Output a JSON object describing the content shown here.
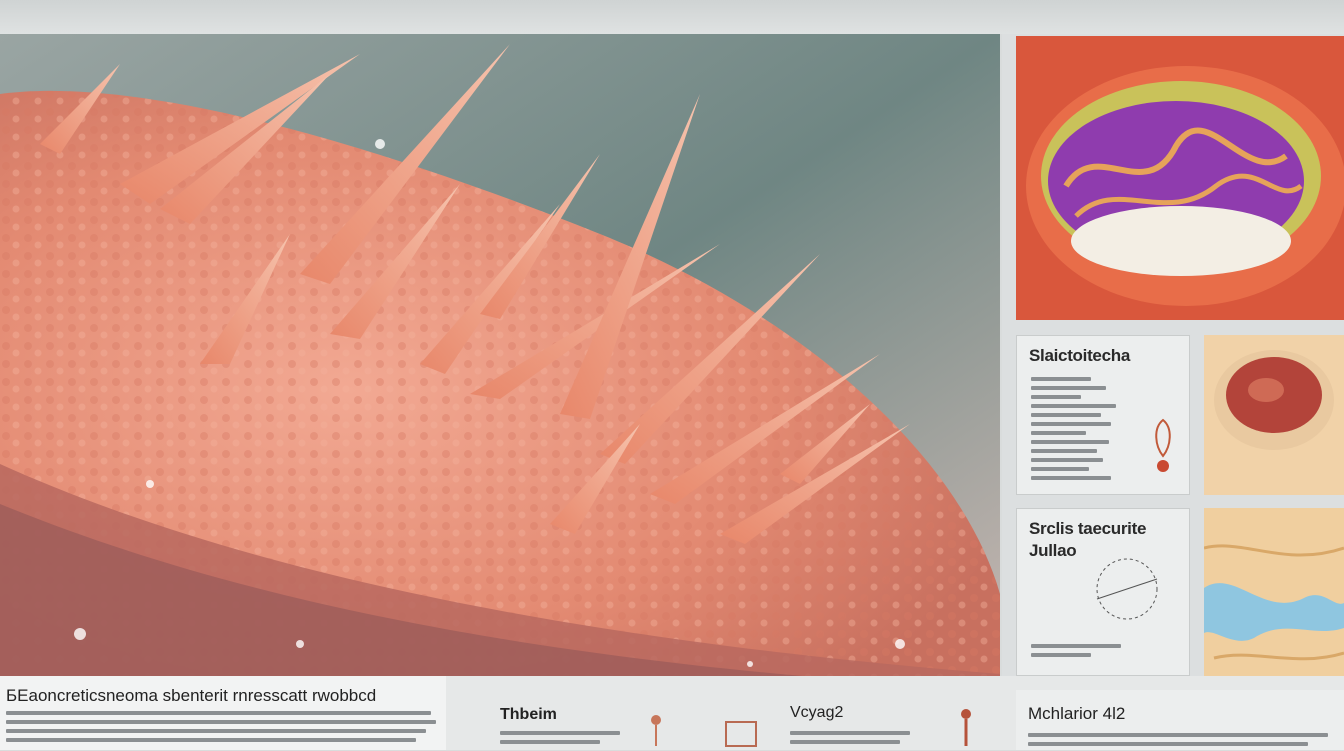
{
  "panels": {
    "panel1_title": "Slaictoitecha",
    "panel2_title_line1": "Srclis taecurite",
    "panel2_title_line2": "Jullao"
  },
  "bottom": {
    "caption_main": "БEaoncreticsneoma sbenterit rnresscatt rwobbcd",
    "caption_a": "Thbeim",
    "caption_b": "Vcyag2",
    "caption_c": "Mchlarior 4l2"
  },
  "colors": {
    "tissue": "#e8917a",
    "spine": "#d97a5e",
    "background_teal": "#6f8683"
  }
}
